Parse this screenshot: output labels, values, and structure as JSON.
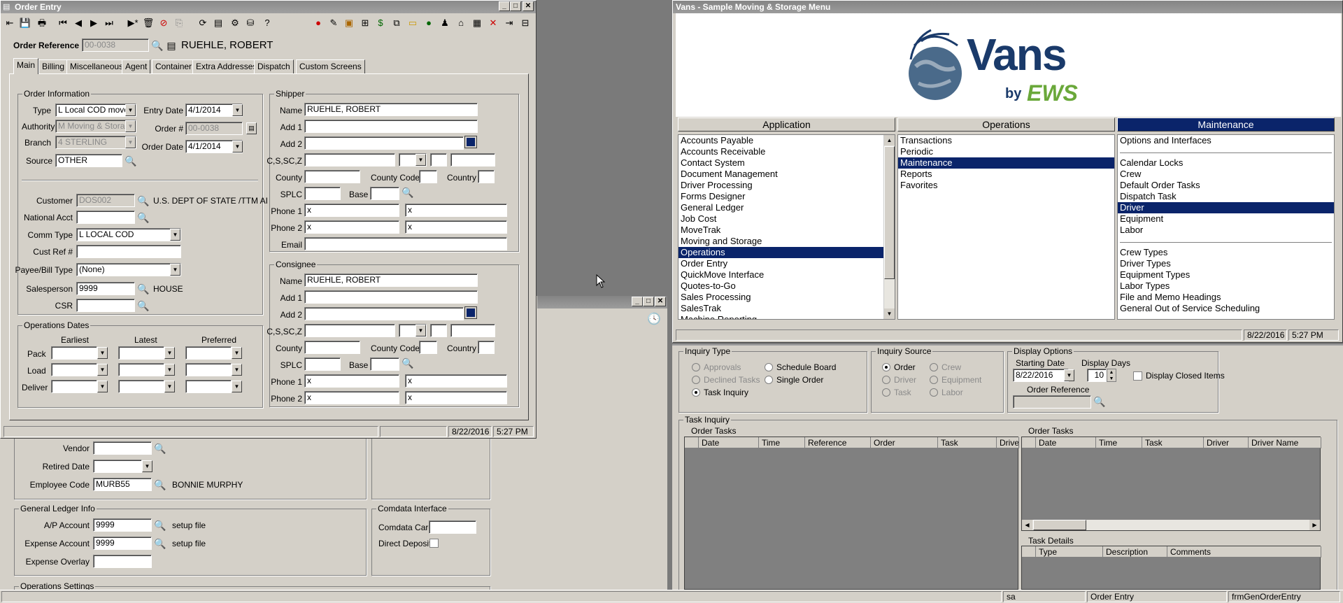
{
  "order_entry": {
    "title": "Order Entry",
    "order_ref_label": "Order Reference",
    "order_ref_value": "00-0038",
    "customer_name": "RUEHLE, ROBERT",
    "tabs": [
      "Main",
      "Billing",
      "Miscellaneous",
      "Agent",
      "Container",
      "Extra Addresses",
      "Dispatch",
      "Custom Screens"
    ],
    "order_info": {
      "title": "Order Information",
      "type_label": "Type",
      "type_value": "L  Local COD move",
      "entry_date_label": "Entry Date",
      "entry_date_value": "4/1/2014",
      "authority_label": "Authority",
      "authority_value": "M  Moving & Storag",
      "order_num_label": "Order #",
      "order_num_value": "00-0038",
      "branch_label": "Branch",
      "branch_value": "4  STERLING",
      "order_date_label": "Order Date",
      "order_date_value": "4/1/2014",
      "source_label": "Source",
      "source_value": "OTHER",
      "customer_label": "Customer",
      "customer_value": "DOS002",
      "customer_desc": "U.S. DEPT OF STATE /TTM AI",
      "national_acct_label": "National Acct",
      "comm_type_label": "Comm Type",
      "comm_type_value": "L  LOCAL COD",
      "cust_ref_label": "Cust Ref #",
      "payee_label": "Payee/Bill Type",
      "payee_value": "(None)",
      "salesperson_label": "Salesperson",
      "salesperson_value": "9999",
      "salesperson_desc": "HOUSE",
      "csr_label": "CSR"
    },
    "ops_dates": {
      "title": "Operations Dates",
      "earliest": "Earliest",
      "latest": "Latest",
      "preferred": "Preferred",
      "pack": "Pack",
      "load": "Load",
      "deliver": "Deliver"
    },
    "shipper": {
      "title": "Shipper",
      "name_label": "Name",
      "name_value": "RUEHLE, ROBERT",
      "add1": "Add 1",
      "add2": "Add 2",
      "csz": "C,S,SC,Z",
      "county": "County",
      "county_code": "County Code",
      "country": "Country",
      "splc": "SPLC",
      "base": "Base",
      "phone1": "Phone 1",
      "phone2": "Phone 2",
      "email": "Email",
      "p1a": "x",
      "p1b": "x",
      "p2a": "x",
      "p2b": "x"
    },
    "consignee": {
      "title": "Consignee",
      "name_label": "Name",
      "name_value": "RUEHLE, ROBERT",
      "add1": "Add 1",
      "add2": "Add 2",
      "csz": "C,S,SC,Z",
      "county": "County",
      "county_code": "County Code",
      "country": "Country",
      "splc": "SPLC",
      "base": "Base",
      "phone1": "Phone 1",
      "phone2": "Phone 2",
      "p1a": "x",
      "p1b": "x",
      "p2a": "x",
      "p2b": "x"
    },
    "status_date": "8/22/2016",
    "status_time": "5:27 PM"
  },
  "driver_form": {
    "vendor_label": "Vendor",
    "retired_label": "Retired Date",
    "employee_label": "Employee Code",
    "employee_value": "MURB55",
    "employee_name": "BONNIE MURPHY",
    "gl_title": "General Ledger Info",
    "ap_label": "A/P Account",
    "ap_value": "9999",
    "ap_desc": "setup file",
    "exp_label": "Expense Account",
    "exp_value": "9999",
    "exp_desc": "setup file",
    "overlay_label": "Expense Overlay",
    "comdata_title": "Comdata Interface",
    "comdata_card": "Comdata Card",
    "direct_deposit": "Direct Deposit",
    "ops_settings": "Operations Settings"
  },
  "vans": {
    "title": "Vans - Sample Moving & Storage Menu",
    "logo_main": "Vans",
    "logo_by": "by",
    "logo_ews": "EWS",
    "headers": [
      "Application",
      "Operations",
      "Maintenance"
    ],
    "application": [
      "Accounts Payable",
      "Accounts Receivable",
      "Contact System",
      "Document Management",
      "Driver Processing",
      "Forms Designer",
      "General Ledger",
      "Job Cost",
      "MoveTrak",
      "Moving and Storage",
      "Operations",
      "Order Entry",
      "QuickMove Interface",
      "Quotes-to-Go",
      "Sales Processing",
      "SalesTrak",
      "Machine Reporting"
    ],
    "operations": [
      "Transactions",
      "Periodic",
      "Maintenance",
      "Reports",
      "Favorites"
    ],
    "maintenance": [
      "Options and Interfaces",
      "",
      "Calendar Locks",
      "Crew",
      "Default Order Tasks",
      "Dispatch Task",
      "Driver",
      "Equipment",
      "Labor",
      "",
      "Crew Types",
      "Driver Types",
      "Equipment Types",
      "Labor Types",
      "File and Memo Headings",
      "General Out of Service Scheduling"
    ],
    "status_date": "8/22/2016",
    "status_time": "5:27 PM"
  },
  "inquiry": {
    "type_title": "Inquiry Type",
    "approvals": "Approvals",
    "declined": "Declined Tasks",
    "task_inquiry": "Task Inquiry",
    "schedule_board": "Schedule Board",
    "single_order": "Single Order",
    "source_title": "Inquiry Source",
    "order": "Order",
    "driver": "Driver",
    "task": "Task",
    "crew": "Crew",
    "equipment": "Equipment",
    "labor": "Labor",
    "display_title": "Display Options",
    "starting_date_label": "Starting Date",
    "starting_date": "8/22/2016",
    "display_days_label": "Display Days",
    "display_days": "10",
    "display_closed": "Display Closed Items",
    "order_ref_label": "Order Reference",
    "task_inquiry_title": "Task Inquiry",
    "order_tasks": "Order Tasks",
    "left_cols": [
      "Date",
      "Time",
      "Reference",
      "Order",
      "Task",
      "Drive"
    ],
    "right_cols": [
      "Date",
      "Time",
      "Task",
      "Driver",
      "Driver Name"
    ],
    "task_details": "Task Details",
    "detail_cols": [
      "Type",
      "Description",
      "Comments"
    ]
  },
  "statusbar": {
    "user": "sa",
    "form": "Order Entry",
    "form_id": "frmGenOrderEntry"
  }
}
